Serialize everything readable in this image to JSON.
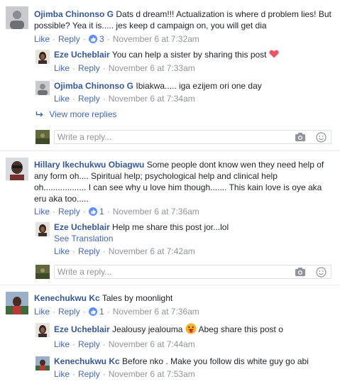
{
  "comments": [
    {
      "author": "Ojimba Chinonso G",
      "text_lines": [
        "Dats d dream!!! Actualization is where d problem lies! But",
        "possible? Yea it is..... jes keep d campaign on, you will get dia"
      ],
      "like": "Like",
      "reply": "Reply",
      "reactions": "3",
      "time": "November 6 at 7:32am",
      "replies": [
        {
          "author": "Eze Ucheblair",
          "text": "You can help a sister by sharing this post",
          "like": "Like",
          "reply": "Reply",
          "time": "November 6 at 7:33am",
          "emoji": "heart-emoji"
        },
        {
          "author": "Ojimba Chinonso G",
          "text": "Ibiakwa..... iga ezijem ori one day",
          "like": "Like",
          "reply": "Reply",
          "time": "November 6 at 7:34am"
        }
      ],
      "view_more": "View more replies",
      "reply_placeholder": "Write a reply..."
    },
    {
      "author": "Hillary Ikechukwu Obiagwu",
      "text_lines": [
        "Some people dont know wen they need help of",
        "any form oh.... Spiritual help; psychological help and clinical help",
        "oh.................. I can see why u love him though....... This kain love is oye aka",
        "eru aka too....."
      ],
      "like": "Like",
      "reply": "Reply",
      "reactions": "1",
      "time": "November 6 at 7:36am",
      "replies": [
        {
          "author": "Eze Ucheblair",
          "text": "Help me share this post jor...lol",
          "see_translation": "See Translation",
          "like": "Like",
          "reply": "Reply",
          "time": "November 6 at 7:42am"
        }
      ],
      "reply_placeholder": "Write a reply..."
    },
    {
      "author": "Kenechukwu Kc",
      "text_lines": [
        "Tales by moonlight"
      ],
      "like": "Like",
      "reply": "Reply",
      "reactions": "1",
      "time": "November 6 at 7:36am",
      "replies": [
        {
          "author": "Eze Ucheblair",
          "text": "Jealousy jealouma",
          "text_after": "Abeg share this post o",
          "emoji": "tongue-out-emoji",
          "like": "Like",
          "reply": "Reply",
          "time": "November 6 at 7:44am"
        },
        {
          "author": "Kenechukwu Kc",
          "text": "Before nko . Make you follow dis white guy go abi",
          "like": "Like",
          "reply": "Reply",
          "time": "November 6 at 7:53am"
        }
      ]
    }
  ],
  "colors": {
    "name": "#365899",
    "link": "#4267b2",
    "meta": "#90949c",
    "like_badge": "#5890ff",
    "heart": "#f25268"
  }
}
